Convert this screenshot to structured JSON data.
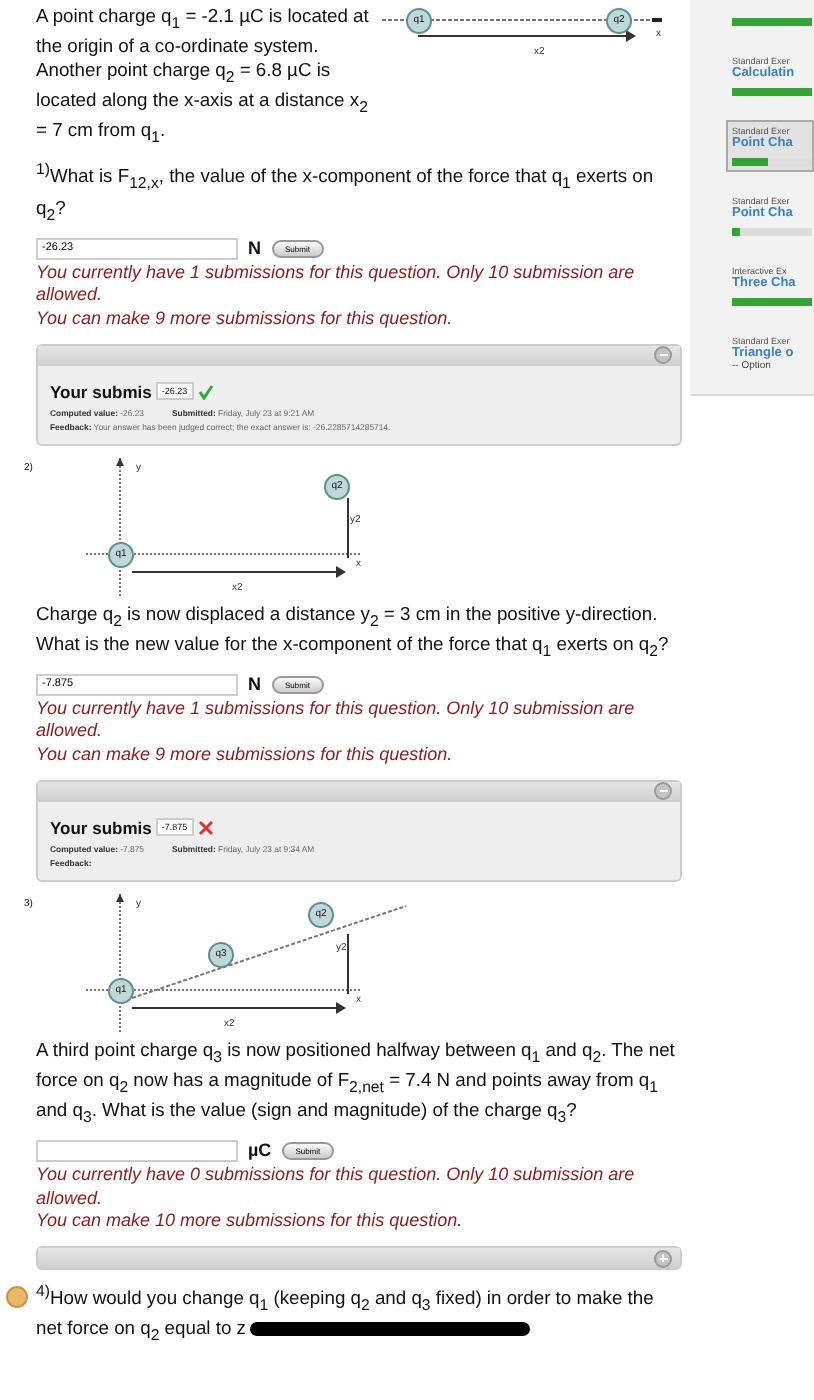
{
  "intro": "A point charge q$_{1}$ = -2.1 µC is located at the origin of a co-ordinate system. Another point charge q$_{2}$ = 6.8 µC is located along the x-axis at a distance x$_{2}$ = 7 cm from q$_{1}$.",
  "questions": [
    {
      "kind": "answer",
      "diagram": {
        "kind": "line",
        "labels": [
          "q1",
          "q2",
          "x",
          "x2"
        ]
      },
      "prompt": "$^{1)}$What is F$_{12,x}$, the value of the x-component of the force that q$_{1}$ exerts on q$_{2}$?",
      "answer": "-26.23",
      "unit": "N",
      "submit": "Submit",
      "messages": [
        "You currently have 1 submissions for this question. Only 10 submission are allowed.",
        "You can make 9 more submissions for this question."
      ],
      "submission": {
        "expanded": true,
        "title": "Your submis",
        "value": "-26.23",
        "correct": true,
        "computed_label": "Computed value:",
        "computed": "-26.23",
        "submitted_label": "Submitted:",
        "submitted": "Friday, July 23 at 9:21 AM",
        "feedback_label": "Feedback:",
        "feedback": "Your answer has been judged correct; the exact answer is: -26.2285714285714."
      }
    },
    {
      "kind": "answer",
      "number": "2)",
      "diagram": {
        "kind": "displaced",
        "labels": [
          "q1",
          "q2",
          "x",
          "y",
          "x2",
          "y2"
        ]
      },
      "prompt": "Charge q$_{2}$ is now displaced a distance y$_{2}$ = 3 cm in the positive y-direction. What is the new value for the x-component of the force that q$_{1}$ exerts on q$_{2}$?",
      "answer": "-7.875",
      "unit": "N",
      "submit": "Submit",
      "messages": [
        "You currently have 1 submissions for this question. Only 10 submission are allowed.",
        "You can make 9 more submissions for this question."
      ],
      "submission": {
        "expanded": true,
        "title": "Your submis",
        "value": "-7.875",
        "correct": false,
        "computed_label": "Computed value:",
        "computed": "-7.875",
        "submitted_label": "Submitted:",
        "submitted": "Friday, July 23 at 9:34 AM",
        "feedback_label": "Feedback:"
      }
    },
    {
      "kind": "answer",
      "number": "3)",
      "diagram": {
        "kind": "three",
        "labels": [
          "q1",
          "q2",
          "q3",
          "x",
          "y",
          "x2",
          "y2"
        ]
      },
      "prompt": "A third point charge q$_{3}$ is now positioned halfway between q$_{1}$ and q$_{2}$. The net force on q$_{2}$ now has a magnitude of F$_{2,net}$ = 7.4 N and points away from q$_{1}$ and q$_{3}$. What is the value (sign and magnitude) of the charge q$_{3}$?",
      "unit": "µC",
      "submit": "Submit",
      "messages": [
        "You currently have 0 submissions for this question. Only 10 submission are allowed.",
        "You can make 10 more submissions for this question."
      ],
      "submission": {
        "expanded": false
      }
    },
    {
      "kind": "open",
      "prompt": "$^{4)}$How would you change q$_{1}$ (keeping q$_{2}$ and q$_{3}$ fixed) in order to make the net force on q$_{2}$ equal to z"
    }
  ],
  "sidebar": {
    "items": [
      {
        "level": 1,
        "selected": false
      },
      {
        "category": "Standard Exer",
        "title": "Calculatin",
        "level": 1,
        "selected": false
      },
      {
        "category": "Standard Exer",
        "title": "Point Cha",
        "level": 0.45,
        "selected": true
      },
      {
        "category": "Standard Exer",
        "title": "Point Cha",
        "level": 0.1,
        "selected": false
      },
      {
        "category": "Interactive Ex",
        "title": "Three Cha",
        "level": 1,
        "selected": false
      },
      {
        "category": "Standard Exer",
        "title": "Triangle o",
        "sub": "-- Option",
        "selected": false
      }
    ]
  }
}
